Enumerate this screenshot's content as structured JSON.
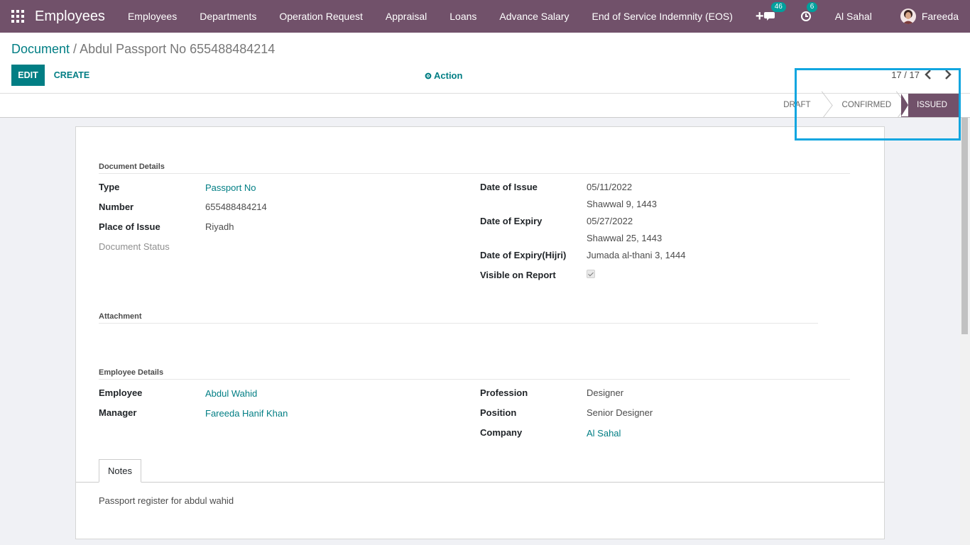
{
  "navbar": {
    "app_title": "Employees",
    "menu": [
      "Employees",
      "Departments",
      "Operation Request",
      "Appraisal",
      "Loans",
      "Advance Salary",
      "End of Service Indemnity (EOS)"
    ],
    "plus": "+",
    "messages_count": "46",
    "activities_count": "6",
    "company": "Al Sahal",
    "user": "Fareeda"
  },
  "breadcrumb": {
    "parent": "Document",
    "separator": " / ",
    "current": "Abdul Passport No 655488484214"
  },
  "buttons": {
    "edit": "EDIT",
    "create": "CREATE",
    "action": "Action"
  },
  "pager": {
    "text": "17 / 17"
  },
  "status": {
    "stages": [
      "DRAFT",
      "CONFIRMED",
      "ISSUED"
    ],
    "active": "ISSUED"
  },
  "document_details": {
    "section": "Document Details",
    "type_label": "Type",
    "type": "Passport No",
    "number_label": "Number",
    "number": "655488484214",
    "place_label": "Place of Issue",
    "place": "Riyadh",
    "doc_status_label": "Document Status",
    "date_issue_label": "Date of Issue",
    "date_issue": "05/11/2022",
    "date_issue_hijri": "Shawwal 9, 1443",
    "date_expiry_label": "Date of Expiry",
    "date_expiry": "05/27/2022",
    "date_expiry_hijri": "Shawwal 25, 1443",
    "expiry_hijri_label": "Date of Expiry(Hijri)",
    "expiry_hijri": "Jumada al-thani 3, 1444",
    "visible_label": "Visible on Report",
    "visible_on_report": true
  },
  "attachment": {
    "section": "Attachment"
  },
  "employee_details": {
    "section": "Employee Details",
    "employee_label": "Employee",
    "employee": "Abdul Wahid",
    "manager_label": "Manager",
    "manager": "Fareeda Hanif Khan",
    "profession_label": "Profession",
    "profession": "Designer",
    "position_label": "Position",
    "position": "Senior Designer",
    "company_label": "Company",
    "company": "Al Sahal"
  },
  "notes": {
    "tab": "Notes",
    "text": "Passport register for abdul wahid"
  },
  "colors": {
    "navbar": "#71516a",
    "accent": "#017e84",
    "highlight": "#11a6e0",
    "badge": "#00a09d"
  }
}
